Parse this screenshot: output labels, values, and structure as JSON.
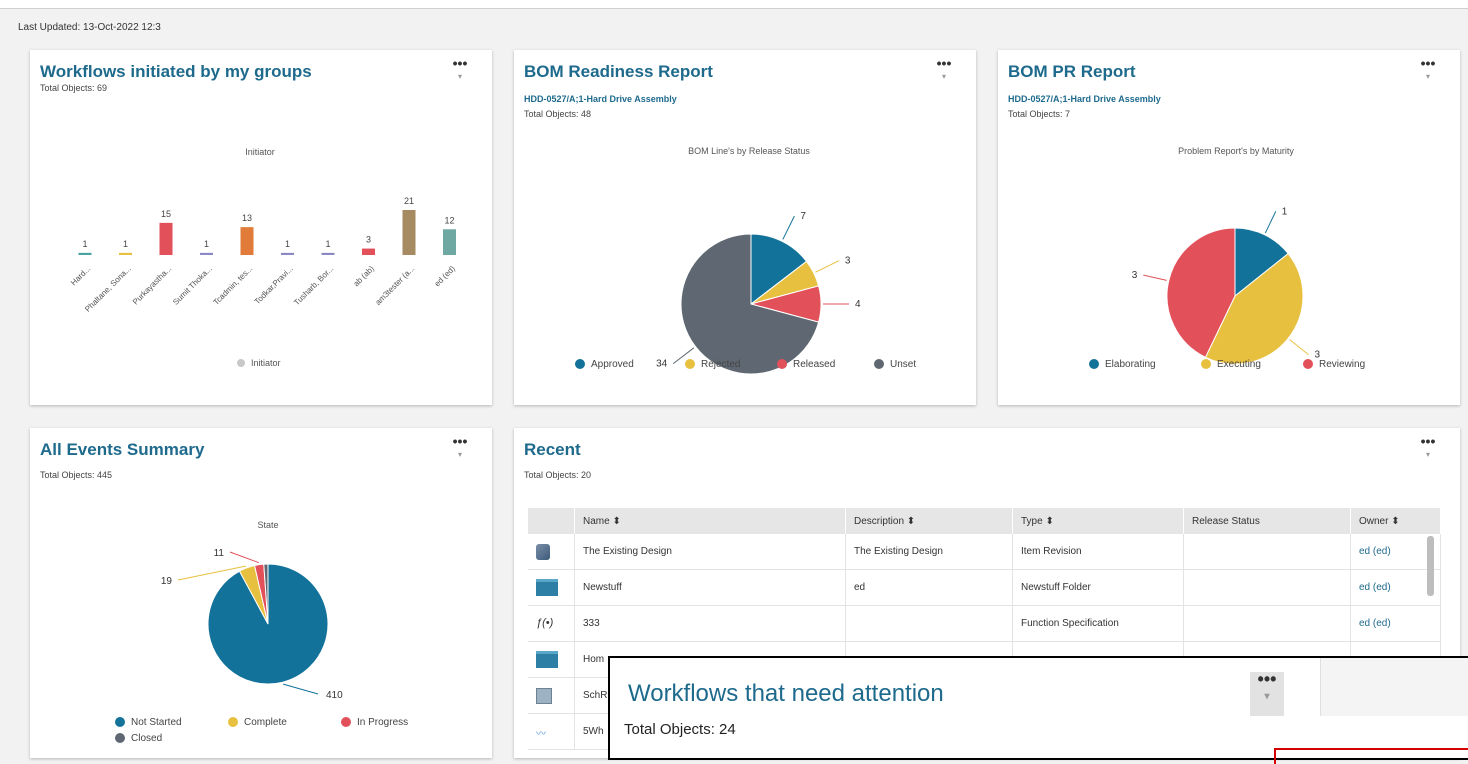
{
  "last_updated": "Last Updated: 13-Oct-2022 12:3",
  "more_icon": "ellipsis-menu-icon",
  "colors": {
    "title": "#1e6a8d",
    "approved": "#13729a",
    "rejected": "#e8c040",
    "released": "#e2505a",
    "unset": "#5f6872",
    "initiator_bars": [
      "#4aa3a0",
      "#e8c040",
      "#e2505a",
      "#8b89c5",
      "#e07b3a",
      "#8b89c5",
      "#8b89c5",
      "#e2505a",
      "#a68b62",
      "#6fa8a2"
    ]
  },
  "card_workflows": {
    "title": "Workflows initiated by my groups",
    "total": "Total Objects: 69",
    "chart_data": {
      "type": "bar",
      "title": "Initiator",
      "categories": [
        "Hard...",
        "Phaltane, Sona...",
        "Purkayastha...",
        "Sumit Thoka...",
        "Tcadmin, tes...",
        "Todkar,Pravi...",
        "Tusharb, Bor...",
        "ab (ab)",
        "am3tester (a...",
        "ed (ed)"
      ],
      "values": [
        1,
        1,
        15,
        1,
        13,
        1,
        1,
        3,
        21,
        12
      ],
      "legend": [
        "Initiator"
      ]
    }
  },
  "card_bom": {
    "title": "BOM Readiness Report",
    "subtitle": "HDD-0527/A;1-Hard Drive Assembly",
    "total": "Total Objects: 48",
    "chart_data": {
      "type": "pie",
      "title": "BOM Line's by Release Status",
      "labels": [
        "Approved",
        "Rejected",
        "Released",
        "Unset"
      ],
      "values": [
        7,
        3,
        4,
        34
      ],
      "legend_position": "bottom"
    }
  },
  "card_pr": {
    "title": "BOM PR Report",
    "subtitle": "HDD-0527/A;1-Hard Drive Assembly",
    "total": "Total Objects: 7",
    "chart_data": {
      "type": "pie",
      "title": "Problem Report's by Maturity",
      "labels": [
        "Elaborating",
        "Executing",
        "Reviewing"
      ],
      "values": [
        1,
        3,
        3
      ],
      "legend_position": "bottom"
    }
  },
  "card_events": {
    "title": "All Events Summary",
    "total": "Total Objects: 445",
    "chart_data": {
      "type": "pie",
      "title": "State",
      "labels": [
        "Not Started",
        "Complete",
        "In Progress",
        "Closed"
      ],
      "values": [
        410,
        19,
        11,
        5
      ],
      "shown_labels": [
        "410",
        "19",
        "11"
      ],
      "legend_position": "bottom"
    }
  },
  "card_recent": {
    "title": "Recent",
    "total": "Total Objects: 20",
    "columns": [
      "Name ⬍",
      "Description ⬍",
      "Type ⬍",
      "Release Status",
      "Owner ⬍"
    ],
    "rows": [
      {
        "icon": "item-revision-icon",
        "name": "The Existing Design",
        "description": "The Existing Design",
        "type": "Item Revision",
        "release": "",
        "owner": "ed (ed)"
      },
      {
        "icon": "folder-icon",
        "name": "Newstuff",
        "description": "ed",
        "type": "Newstuff Folder",
        "release": "",
        "owner": "ed (ed)"
      },
      {
        "icon": "function-icon",
        "name": "333",
        "description": "",
        "type": "Function Specification",
        "release": "",
        "owner": "ed (ed)"
      },
      {
        "icon": "folder-icon",
        "name": "Hom",
        "description": "",
        "type": "",
        "release": "",
        "owner": ""
      },
      {
        "icon": "schematic-icon",
        "name": "SchR",
        "description": "",
        "type": "",
        "release": "",
        "owner": ""
      },
      {
        "icon": "graph-icon",
        "name": "5Wh",
        "description": "",
        "type": "",
        "release": "",
        "owner": ""
      }
    ]
  },
  "popup": {
    "title": "Workflows that need attention",
    "total": "Total Objects: 24"
  }
}
